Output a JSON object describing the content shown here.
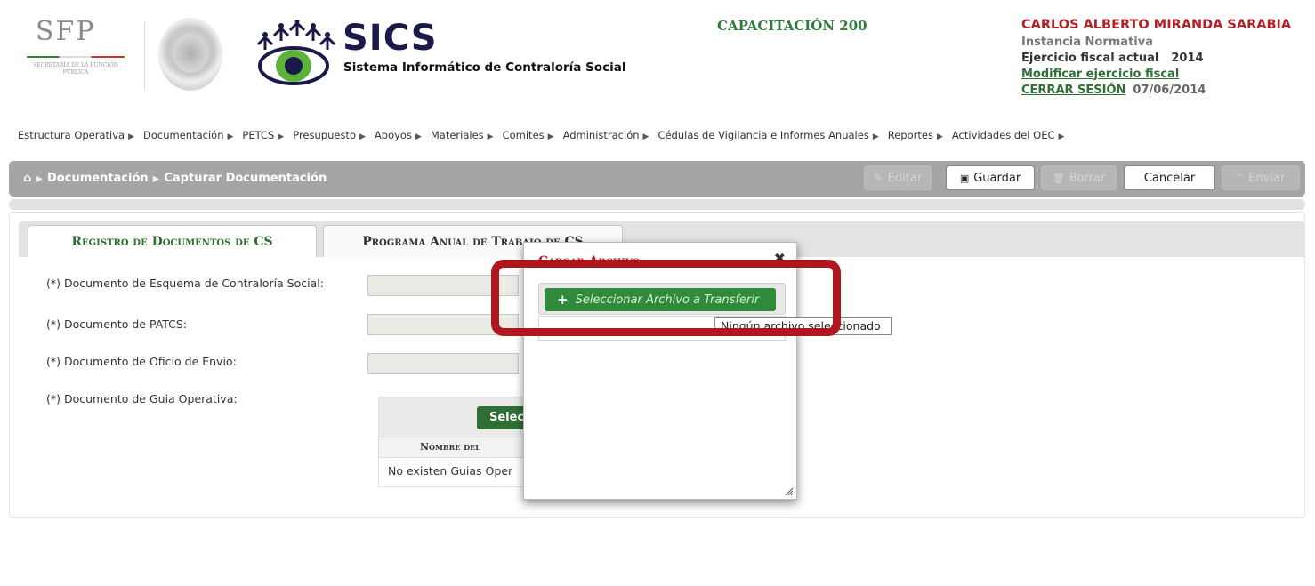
{
  "header": {
    "sfp_logo_text": "SFP",
    "sfp_subtitle": "SECRETARÍA DE LA FUNCIÓN PÚBLICA",
    "app_title": "SICS",
    "app_subtitle": "Sistema Informático de Contraloría Social",
    "environment": "CAPACITACIÓN 200",
    "user": {
      "name": "CARLOS ALBERTO MIRANDA SARABIA",
      "role": "Instancia Normativa",
      "fiscal_label": "Ejercicio fiscal actual",
      "fiscal_year": "2014",
      "modify_link": "Modificar ejercicio fiscal",
      "logout_link": "CERRAR SESIÓN",
      "date": "07/06/2014"
    }
  },
  "menu": [
    {
      "label": "Estructura Operativa"
    },
    {
      "label": "Documentación"
    },
    {
      "label": "PETCS"
    },
    {
      "label": "Presupuesto"
    },
    {
      "label": "Apoyos"
    },
    {
      "label": "Materiales"
    },
    {
      "label": "Comites"
    },
    {
      "label": "Administración"
    },
    {
      "label": "Cédulas de Vigilancia e Informes Anuales"
    },
    {
      "label": "Reportes"
    },
    {
      "label": "Actividades del OEC"
    }
  ],
  "breadcrumb": {
    "home_icon": "home-icon",
    "level1": "Documentación",
    "level2": "Capturar Documentación"
  },
  "toolbar": {
    "edit_label": "Editar",
    "save_label": "Guardar",
    "delete_label": "Borrar",
    "cancel_label": "Cancelar",
    "send_label": "Enviar"
  },
  "tabs": [
    {
      "label": "Registro de Documentos de CS"
    },
    {
      "label": "Programa Anual de Trabajo de CS"
    }
  ],
  "form": {
    "esquema_label": "(*) Documento de Esquema de Contraloría Social:",
    "patcs_label": "(*) Documento de PATCS:",
    "oficio_label": "(*) Documento de Oficio de Envio:",
    "guia_label": "(*) Documento de Guia Operativa:",
    "guia_button": "Selecc",
    "guia_column": "Nombre del",
    "guia_empty": "No existen Guias Oper"
  },
  "modal": {
    "title": "Cargar Archivo",
    "select_button": "Seleccionar Archivo a Transferir",
    "tooltip": "Ningún archivo seleccionado"
  },
  "colors": {
    "brand_green": "#2f6f35",
    "brand_red": "#b21f24",
    "highlight_red": "#b0161e"
  }
}
